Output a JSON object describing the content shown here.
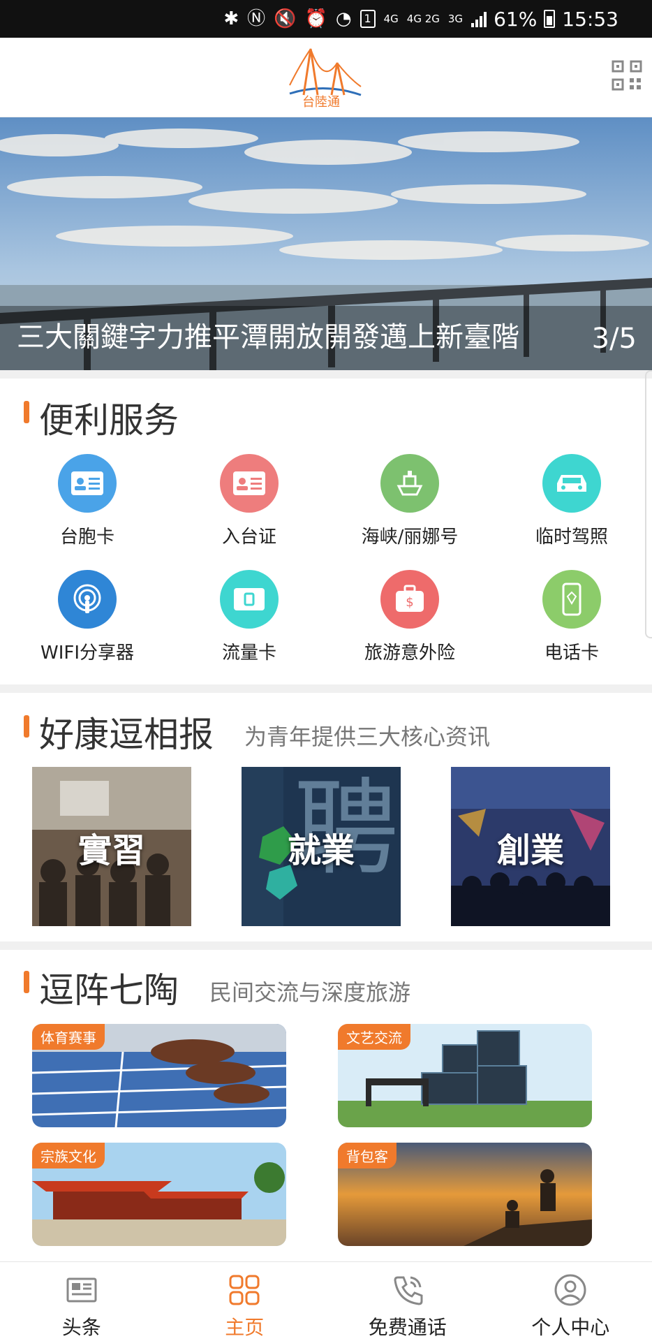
{
  "status_bar": {
    "net1": "4G",
    "net2": "4G 2G",
    "net3": "3G",
    "sim_badge": "1",
    "battery": "61%",
    "time": "15:53"
  },
  "header": {
    "logo_text": "台陸通",
    "qr_icon": "qr-code-icon"
  },
  "banner": {
    "title": "三大關鍵字力推平潭開放開發邁上新臺階",
    "counter": "3/5"
  },
  "services": {
    "title": "便利服务",
    "items": [
      {
        "label": "台胞卡",
        "icon": "id-card-icon",
        "color": "#4aa3e8"
      },
      {
        "label": "入台证",
        "icon": "permit-card-icon",
        "color": "#ee7d7d"
      },
      {
        "label": "海峡/丽娜号",
        "icon": "ship-icon",
        "color": "#7dc16f"
      },
      {
        "label": "临时驾照",
        "icon": "car-icon",
        "color": "#3ed6d0"
      },
      {
        "label": "WIFI分享器",
        "icon": "wifi-hotspot-icon",
        "color": "#2f86d6"
      },
      {
        "label": "流量卡",
        "icon": "sim-card-icon",
        "color": "#3ed6d0"
      },
      {
        "label": "旅游意外险",
        "icon": "luggage-insurance-icon",
        "color": "#ee6b6b"
      },
      {
        "label": "电话卡",
        "icon": "phone-card-icon",
        "color": "#8ccc6a"
      }
    ]
  },
  "news": {
    "title": "好康逗相报",
    "subtitle": "为青年提供三大核心资讯",
    "cards": [
      {
        "label": "實習"
      },
      {
        "label": "就業"
      },
      {
        "label": "創業"
      }
    ]
  },
  "travel": {
    "title": "逗阵七陶",
    "subtitle": "民间交流与深度旅游",
    "tiles": [
      {
        "tag": "体育赛事"
      },
      {
        "tag": "文艺交流"
      },
      {
        "tag": "宗族文化"
      },
      {
        "tag": "背包客"
      }
    ]
  },
  "bottom_nav": [
    {
      "label": "头条",
      "icon": "newspaper-icon",
      "active": false
    },
    {
      "label": "主页",
      "icon": "grid-home-icon",
      "active": true
    },
    {
      "label": "免费通话",
      "icon": "phone-call-icon",
      "active": false
    },
    {
      "label": "个人中心",
      "icon": "user-profile-icon",
      "active": false
    }
  ],
  "colors": {
    "accent": "#f07a2c"
  }
}
